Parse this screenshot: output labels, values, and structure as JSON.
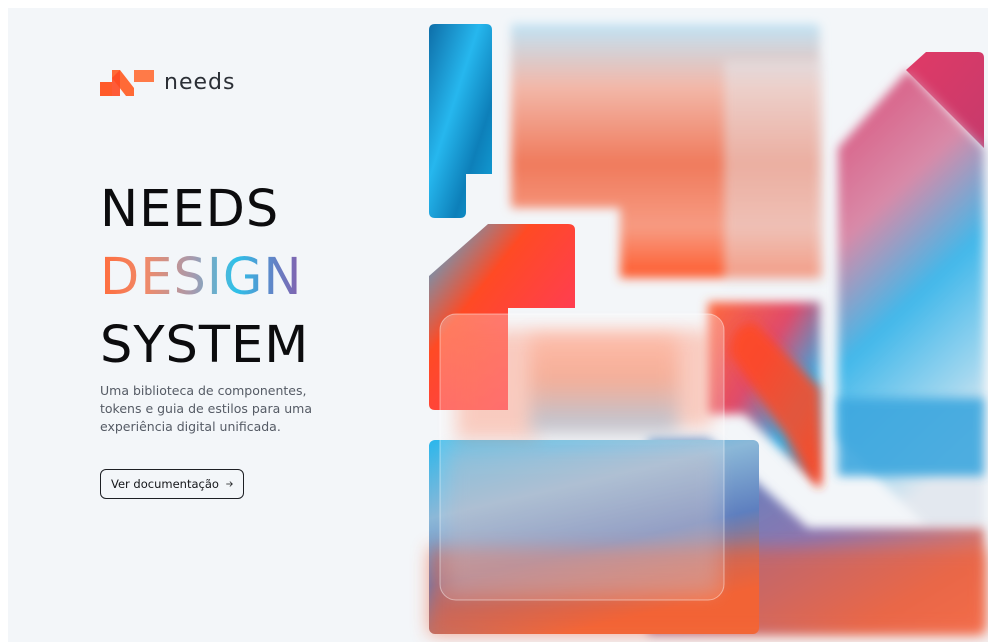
{
  "brand": {
    "logo_icon": "needs-logo-mark-icon",
    "name": "needs",
    "accent": "#ff5a2a"
  },
  "hero": {
    "title_line1": "NEEDS",
    "title_line2": "DESIGN",
    "title_line3": "SYSTEM",
    "description": "Uma biblioteca de componentes, tokens e guia de estilos para uma experiência digital unificada.",
    "cta_label": "Ver documentação",
    "cta_icon": "arrow-right-icon"
  },
  "artwork": {
    "icon": "abstract-gradient-shapes-illustration",
    "colors": [
      "#ff4a1f",
      "#2ec1f0",
      "#e2345c",
      "#1287c2",
      "#f6a089"
    ]
  }
}
